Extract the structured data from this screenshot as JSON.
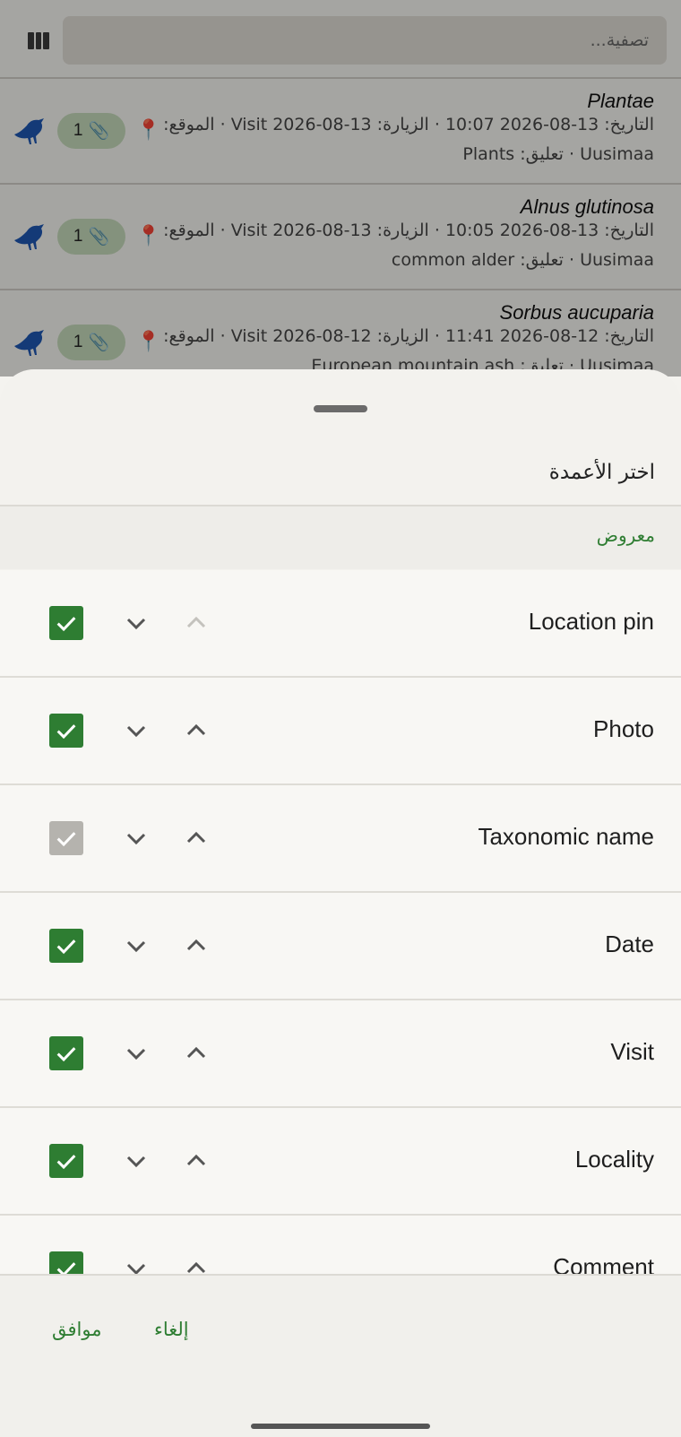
{
  "header": {
    "search_placeholder": "تصفية..."
  },
  "observations": [
    {
      "title": "Plantae",
      "line2": "التاريخ: 13-08-2026 10:07 · الزيارة: Visit 2026-08-13 · الموقع:",
      "line3": "Uusimaa · تعليق: Plants",
      "attachments": "1"
    },
    {
      "title": "Alnus glutinosa",
      "line2": "التاريخ: 13-08-2026 10:05 · الزيارة: Visit 2026-08-13 · الموقع:",
      "line3": "Uusimaa · تعليق: common alder",
      "attachments": "1"
    },
    {
      "title": "Sorbus aucuparia",
      "line2": "التاريخ: 12-08-2026 11:41 · الزيارة: Visit 2026-08-12 · الموقع:",
      "line3": "Uusimaa · تعليق: European mountain ash",
      "attachments": "1"
    }
  ],
  "sheet": {
    "title": "اختر الأعمدة",
    "section_label": "معروض",
    "columns": [
      {
        "label": "Location pin",
        "checked": true,
        "locked": false,
        "up_enabled": false
      },
      {
        "label": "Photo",
        "checked": true,
        "locked": false,
        "up_enabled": true
      },
      {
        "label": "Taxonomic name",
        "checked": true,
        "locked": true,
        "up_enabled": true
      },
      {
        "label": "Date",
        "checked": true,
        "locked": false,
        "up_enabled": true
      },
      {
        "label": "Visit",
        "checked": true,
        "locked": false,
        "up_enabled": true
      },
      {
        "label": "Locality",
        "checked": true,
        "locked": false,
        "up_enabled": true
      },
      {
        "label": "Comment",
        "checked": true,
        "locked": false,
        "up_enabled": true
      }
    ],
    "ok_label": "موافق",
    "cancel_label": "إلغاء"
  },
  "colors": {
    "accent": "#2e7d32",
    "bird": "#1e56b0"
  }
}
